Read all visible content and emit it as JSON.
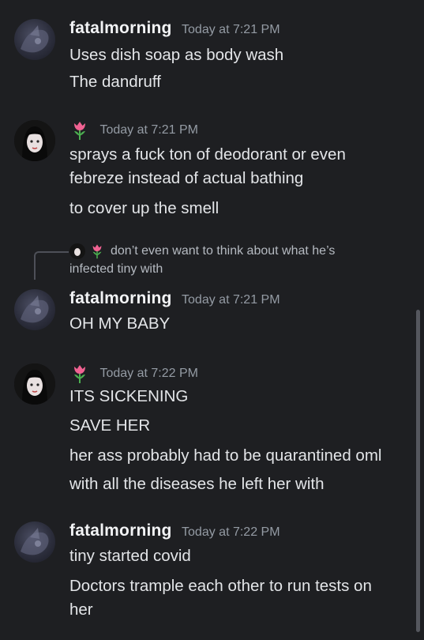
{
  "messages": [
    {
      "author": "fatalmorning",
      "timestamp": "Today at 7:21 PM",
      "lines": [
        "Uses dish soap as body wash",
        "The dandruff"
      ]
    },
    {
      "author": "🌷",
      "timestamp": "Today at 7:21 PM",
      "lines": [
        "sprays a fuck ton of deodorant or even",
        "febreze instead of actual bathing",
        "to cover up the smell"
      ]
    },
    {
      "reply_preview": "don’t even want to think about what he’s",
      "reply_preview_cont": "infected tiny with",
      "author": "fatalmorning",
      "timestamp": "Today at 7:21 PM",
      "lines": [
        "OH MY BABY"
      ]
    },
    {
      "author": "🌷",
      "timestamp": "Today at 7:22 PM",
      "lines": [
        "ITS SICKENING",
        "SAVE HER",
        "her ass probably had to be quarantined oml",
        "with all the diseases he left her with"
      ]
    },
    {
      "author": "fatalmorning",
      "timestamp": "Today at 7:22 PM",
      "lines": [
        "tiny started covid",
        "Doctors trample each other to run tests on",
        "her"
      ]
    }
  ],
  "colors": {
    "background": "#1e1f22",
    "username": "#f2f3f5",
    "timestamp": "#949ba4",
    "message_text": "#e3e5e8",
    "reply_text": "#b5bac1"
  }
}
